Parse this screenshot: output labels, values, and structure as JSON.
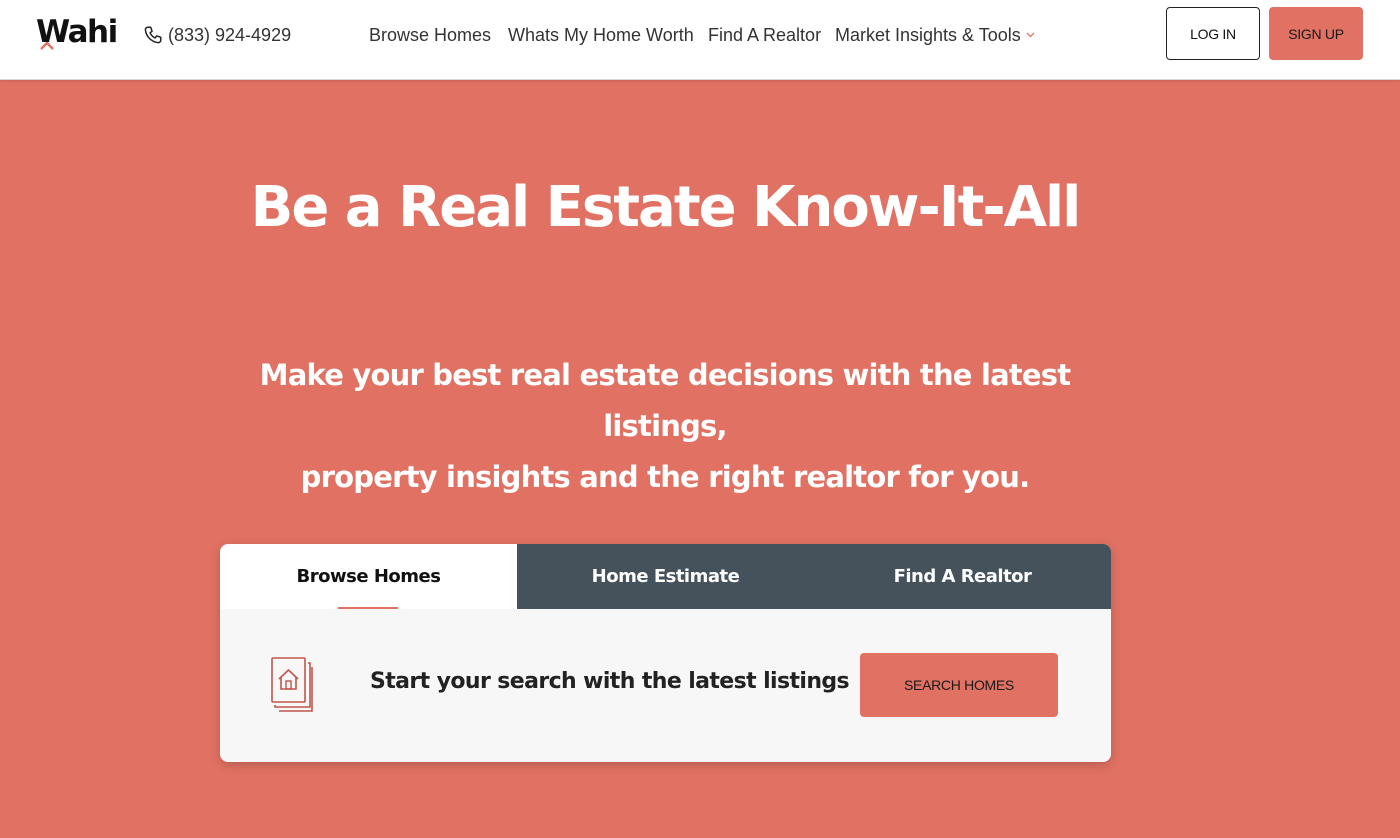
{
  "brand": {
    "logo_text": "Wahi",
    "phone": "(833) 924-4929",
    "accent_color": "#e07163",
    "tab_bar_color": "#45525c"
  },
  "nav": {
    "items": [
      {
        "label": "Browse Homes"
      },
      {
        "label": "Whats My Home Worth"
      },
      {
        "label": "Find A Realtor"
      },
      {
        "label": "Market Insights & Tools",
        "has_dropdown": true
      }
    ]
  },
  "auth": {
    "login_label": "LOG IN",
    "signup_label": "SIGN UP"
  },
  "hero": {
    "title": "Be a Real Estate Know-It-All",
    "subtitle_line1": "Make your best real estate decisions with the latest listings,",
    "subtitle_line2": "property insights and the right realtor for you."
  },
  "search_card": {
    "tabs": [
      {
        "label": "Browse Homes",
        "active": true
      },
      {
        "label": "Home Estimate",
        "active": false
      },
      {
        "label": "Find A Realtor",
        "active": false
      }
    ],
    "panel_icon": "house-listing-icon",
    "panel_text": "Start your search with the latest listings",
    "cta_label": "SEARCH HOMES"
  }
}
